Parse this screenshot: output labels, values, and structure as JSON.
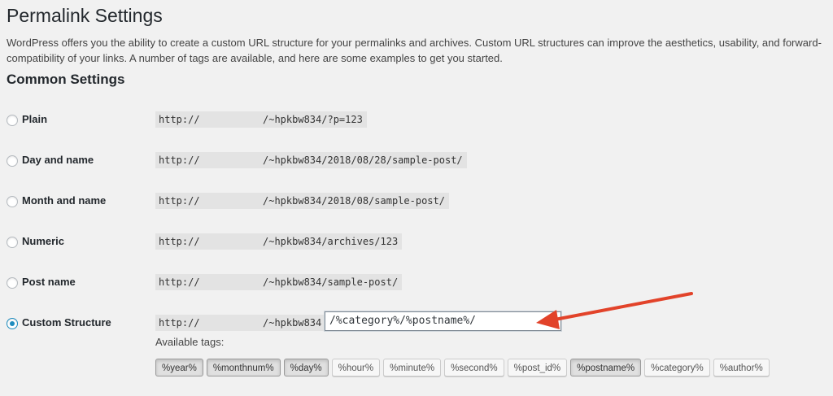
{
  "page": {
    "title": "Permalink Settings",
    "intro": "WordPress offers you the ability to create a custom URL structure for your permalinks and archives. Custom URL structures can improve the aesthetics, usability, and forward-compatibility of your links. A number of tags are available, and here are some examples to get you started.",
    "section_title": "Common Settings"
  },
  "options": [
    {
      "label": "Plain",
      "host": "http://",
      "path": "/~hpkbw834/?p=123",
      "checked": false
    },
    {
      "label": "Day and name",
      "host": "http://",
      "path": "/~hpkbw834/2018/08/28/sample-post/",
      "checked": false
    },
    {
      "label": "Month and name",
      "host": "http://",
      "path": "/~hpkbw834/2018/08/sample-post/",
      "checked": false
    },
    {
      "label": "Numeric",
      "host": "http://",
      "path": "/~hpkbw834/archives/123",
      "checked": false
    },
    {
      "label": "Post name",
      "host": "http://",
      "path": "/~hpkbw834/sample-post/",
      "checked": false
    },
    {
      "label": "Custom Structure",
      "host": "http://",
      "path": "/~hpkbw834",
      "checked": true
    }
  ],
  "custom_structure": {
    "value": "/%category%/%postname%/"
  },
  "available_tags_label": "Available tags:",
  "tags": [
    {
      "label": "%year%",
      "active": true
    },
    {
      "label": "%monthnum%",
      "active": true
    },
    {
      "label": "%day%",
      "active": true
    },
    {
      "label": "%hour%",
      "active": false
    },
    {
      "label": "%minute%",
      "active": false
    },
    {
      "label": "%second%",
      "active": false
    },
    {
      "label": "%post_id%",
      "active": false
    },
    {
      "label": "%postname%",
      "active": true
    },
    {
      "label": "%category%",
      "active": false
    },
    {
      "label": "%author%",
      "active": false
    }
  ],
  "colors": {
    "background": "#f1f1f1",
    "radio_checked": "#1e8cbe",
    "annotation_arrow": "#e2432a"
  },
  "annotation": {
    "icon": "red-arrow-icon"
  }
}
